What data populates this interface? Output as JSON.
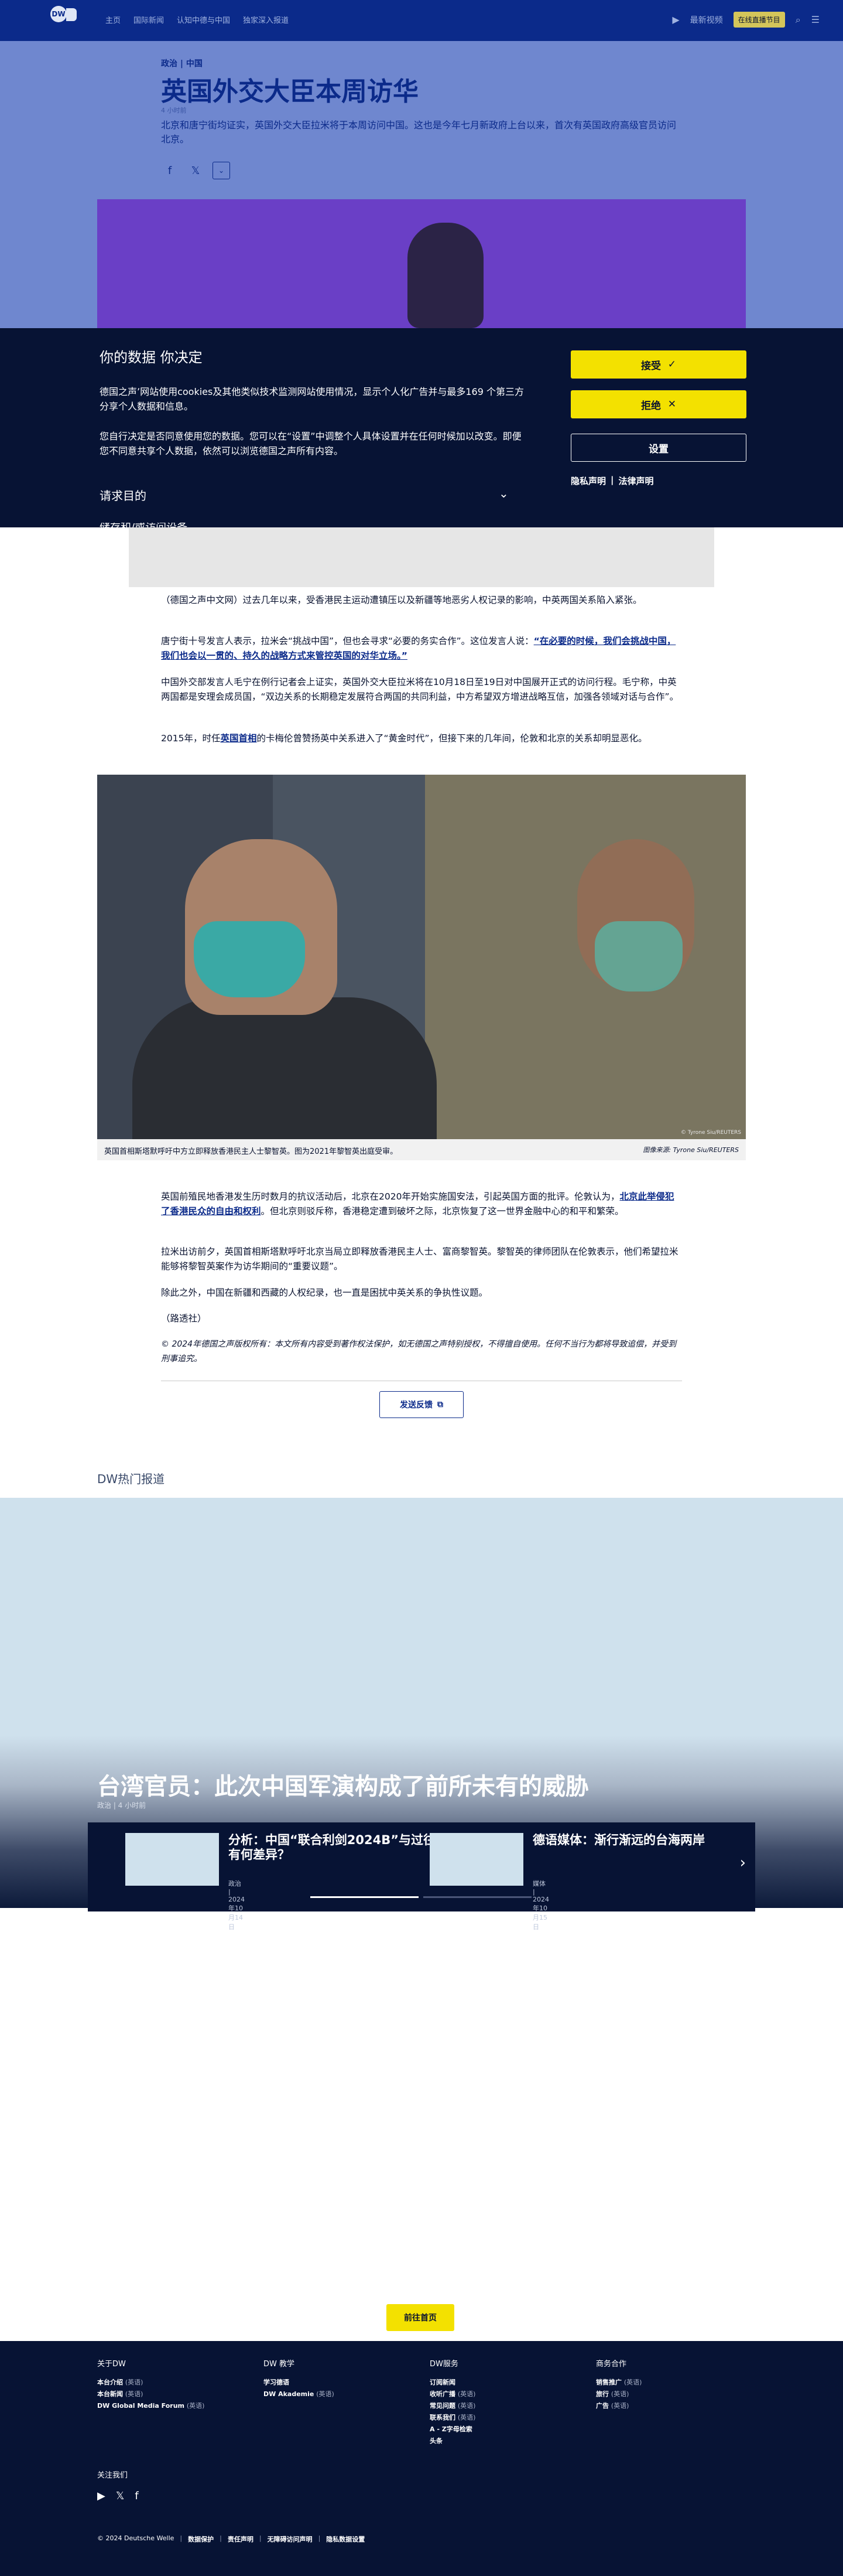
{
  "header": {
    "logo": "DW",
    "nav": [
      "主页",
      "国际新闻",
      "认知中德与中国",
      "独家深入报道"
    ],
    "live_tv": "最新视频",
    "lang_button": "在线直播节目",
    "search_icon": "search-icon",
    "menu_icon": "hamburger-menu-icon"
  },
  "article": {
    "breadcrumb": "政治 | 中国",
    "title": "英国外交大臣本周访华",
    "time": "4 小时前",
    "lead": "北京和唐宁街均证实，英国外交大臣拉米将于本周访问中国。这也是今年七月新政府上台以来，首次有英国政府高级官员访问北京。",
    "share_icons": [
      "facebook-icon",
      "x-icon",
      "chevron-down-icon"
    ],
    "paragraphs": [
      "（德国之声中文网）过去几年以来，受香港民主运动遭镇压以及新疆等地恶劣人权记录的影响，中英两国关系陷入紧张。",
      "中国外交部发言人毛宁在例行记者会上证实，英国外交大臣拉米将在10月18日至19日对中国展开正式的访问行程。毛宁称，中英两国都是安理会成员国，“双边关系的长期稳定发展符合两国的共同利益，中方希望双方增进战略互信，加强各领域对话与合作”。",
      "英国前殖民地香港发生历时数月的抗议活动后，北京在2020年开始实施国安法，引起英国方面的批评。伦敦认为，",
      "拉米出访前夕，英国首相斯塔默呼吁北京当局立即释放香港民主人士、富商黎智英。黎智英的律师团队在伦敦表示，他们希望拉米能够将黎智英案作为访华期间的“重要议题”。",
      "除此之外，中国在新疆和西藏的人权纪录，也一直是困扰中英关系的争执性议题。",
      "（路透社）"
    ],
    "p2_before": "唐宁街十号发言人表示，拉米会“挑战中国”，但也会寻求“必要的务实合作”。这位发言人说：",
    "p2_quote": "“在必要的时候，我们会挑战中国，我们也会以一贯的、持久的战略方式来管控英国的对华立场。”",
    "p4_before": "2015年，时任",
    "p4_link": "英国首相",
    "p4_after": "的卡梅伦曾赞扬英中关系进入了“黄金时代”，但接下来的几年间，伦敦和北京的关系却明显恶化。",
    "p5_link": "北京此举侵犯了香港民众的自由和权利",
    "p5_after": "。但北京则驳斥称，香港稳定遭到破坏之际，北京恢复了这一世界金融中心的和平和繁荣。",
    "copyright": "© 2024年德国之声版权所有：本文所有内容受到著作权法保护，如无德国之声特别授权，不得擅自使用。任何不当行为都将导致追偿，并受到刑事追究。",
    "photo_credit": "© Tyrone Siu/REUTERS",
    "caption": "英国首相斯塔默呼吁中方立即释放香港民主人士黎智英。图为2021年黎智英出庭受审。",
    "caption_src": "图像来源: Tyrone Siu/REUTERS",
    "feedback_label": "发送反馈"
  },
  "consent": {
    "title": "你的数据 你决定",
    "text1": "德国之声’网站使用cookies及其他类似技术监测网站使用情况，显示个人化广告并与最多169 个第三方分享个人数据和信息。",
    "text2": "您自行决定是否同意使用您的数据。您可以在“设置”中调整个人具体设置并在任何时候加以改变。即便您不同意共享个人数据，依然可以浏览德国之声所有内容。",
    "purpose": "请求目的",
    "accept": "接受",
    "reject": "拒绝",
    "settings": "设置",
    "privacy": "隐私声明",
    "legal": "法律声明",
    "cut_text": "储存和/或访问设备"
  },
  "hot": {
    "section_title": "DW热门报道",
    "main_title": "台湾官员：此次中国军演构成了前所未有的威胁",
    "main_meta": "政治 | 4 小时前",
    "slides": [
      {
        "title": "分析：中国“联合利剑2024B”与过往有何差异？",
        "meta": "政治 | 2024年10月14日"
      },
      {
        "title": "德语媒体：渐行渐远的台海两岸",
        "meta": "媒体 | 2024年10月15日"
      }
    ]
  },
  "home_button": "前往首页",
  "footer": {
    "columns": [
      {
        "heading": "关于DW",
        "items": [
          [
            "本台介绍",
            "(英语)"
          ],
          [
            "本台新闻",
            "(英语)"
          ],
          [
            "DW Global Media Forum",
            "(英语)"
          ]
        ]
      },
      {
        "heading": "DW 教学",
        "items": [
          [
            "学习德语",
            ""
          ],
          [
            "DW Akademie",
            "(英语)"
          ]
        ]
      },
      {
        "heading": "DW服务",
        "items": [
          [
            "订阅新闻",
            ""
          ],
          [
            "收听广播",
            "(英语)"
          ],
          [
            "常见问题",
            "(英语)"
          ],
          [
            "联系我们",
            "(英语)"
          ],
          [
            "A - Z字母检索",
            ""
          ],
          [
            "头条",
            ""
          ]
        ]
      },
      {
        "heading": "商务合作",
        "items": [
          [
            "销售推广",
            "(英语)"
          ],
          [
            "旅行",
            "(英语)"
          ],
          [
            "广告",
            "(英语)"
          ]
        ]
      }
    ],
    "follow": "关注我们",
    "social_icons": [
      "youtube-icon",
      "x-icon",
      "facebook-icon"
    ],
    "legal": [
      "© 2024 Deutsche Welle",
      "数据保护",
      "责任声明",
      "无障碍访问声明",
      "隐私数据设置"
    ]
  }
}
